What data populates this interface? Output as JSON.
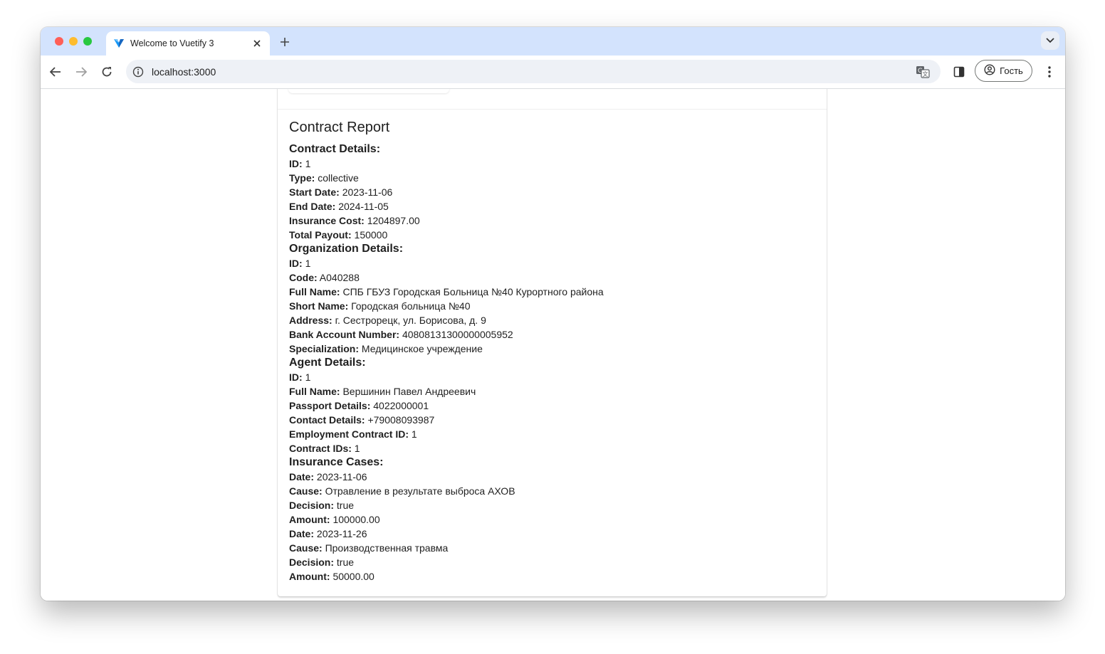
{
  "browser": {
    "tab_title": "Welcome to Vuetify 3",
    "url": "localhost:3000",
    "profile_label": "Гость",
    "accent": "#1867c0"
  },
  "report": {
    "title": "Contract Report",
    "contract": {
      "heading": "Contract Details:",
      "fields": [
        {
          "label": "ID:",
          "value": "1"
        },
        {
          "label": "Type:",
          "value": "collective"
        },
        {
          "label": "Start Date:",
          "value": "2023-11-06"
        },
        {
          "label": "End Date:",
          "value": "2024-11-05"
        },
        {
          "label": "Insurance Cost:",
          "value": "1204897.00"
        },
        {
          "label": "Total Payout:",
          "value": "150000"
        }
      ]
    },
    "organization": {
      "heading": "Organization Details:",
      "fields": [
        {
          "label": "ID:",
          "value": "1"
        },
        {
          "label": "Code:",
          "value": "A040288"
        },
        {
          "label": "Full Name:",
          "value": "СПБ ГБУЗ Городская Больница №40 Курортного района"
        },
        {
          "label": "Short Name:",
          "value": "Городская больница №40"
        },
        {
          "label": "Address:",
          "value": "г. Сестрорецк, ул. Борисова, д. 9"
        },
        {
          "label": "Bank Account Number:",
          "value": "40808131300000005952"
        },
        {
          "label": "Specialization:",
          "value": "Медицинское учреждение"
        }
      ]
    },
    "agent": {
      "heading": "Agent Details:",
      "fields": [
        {
          "label": "ID:",
          "value": "1"
        },
        {
          "label": "Full Name:",
          "value": "Вершинин Павел Андреевич"
        },
        {
          "label": "Passport Details:",
          "value": "4022000001"
        },
        {
          "label": "Contact Details:",
          "value": "+79008093987"
        },
        {
          "label": "Employment Contract ID:",
          "value": "1"
        },
        {
          "label": "Contract IDs:",
          "value": "1"
        }
      ]
    },
    "cases": {
      "heading": "Insurance Cases:",
      "fields": [
        {
          "label": "Date:",
          "value": "2023-11-06"
        },
        {
          "label": "Cause:",
          "value": "Отравление в результате выброса АХОВ"
        },
        {
          "label": "Decision:",
          "value": "true"
        },
        {
          "label": "Amount:",
          "value": "100000.00"
        },
        {
          "label": "Date:",
          "value": "2023-11-26"
        },
        {
          "label": "Cause:",
          "value": "Производственная травма"
        },
        {
          "label": "Decision:",
          "value": "true"
        },
        {
          "label": "Amount:",
          "value": "50000.00"
        }
      ]
    }
  }
}
